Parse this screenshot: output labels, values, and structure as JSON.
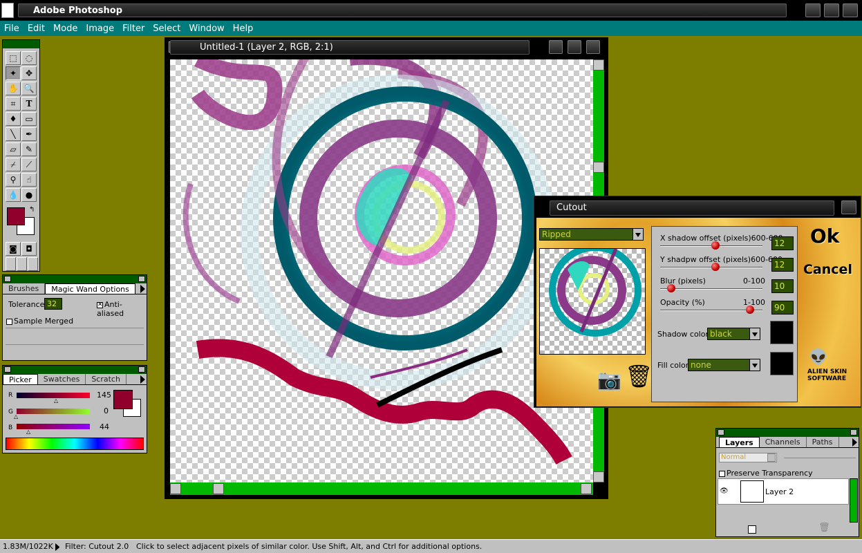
{
  "app": {
    "title": "Adobe Photoshop"
  },
  "menu": [
    "File",
    "Edit",
    "Mode",
    "Image",
    "Filter",
    "Select",
    "Window",
    "Help"
  ],
  "document": {
    "title": "Untitled-1  (Layer 2, RGB, 2:1)"
  },
  "brushes_panel": {
    "tabs": [
      "Brushes",
      "Magic Wand Options"
    ],
    "tolerance_label": "Tolerance:",
    "tolerance_value": "32",
    "anti_aliased_label": "Anti-aliased",
    "sample_merged_label": "Sample Merged"
  },
  "picker_panel": {
    "tabs": [
      "Picker",
      "Swatches",
      "Scratch"
    ],
    "channels": [
      {
        "label": "R",
        "value": "145"
      },
      {
        "label": "G",
        "value": "0"
      },
      {
        "label": "B",
        "value": "44"
      }
    ],
    "foreground_color": "#91002c"
  },
  "cutout": {
    "title": "Cutout",
    "preset": "Ripped",
    "x_offset_label": "X shadow offset (pixels)",
    "x_offset_range": "600-600",
    "x_offset_value": "12",
    "y_offset_label": "Y shadpw offset (pixels)",
    "y_offset_range": "600-600",
    "y_offset_value": "12",
    "blur_label": "Blur (pixels)",
    "blur_range": "0-100",
    "blur_value": "10",
    "opacity_label": "Opacity (%)",
    "opacity_range": "1-100",
    "opacity_value": "90",
    "shadow_color_label": "Shadow color:",
    "shadow_color_value": "black",
    "fill_color_label": "Fill color:",
    "fill_color_value": "none",
    "ok_label": "Ok",
    "cancel_label": "Cancel",
    "logo_text": "ALIEN SKIN SOFTWARE"
  },
  "layers_panel": {
    "tabs": [
      "Layers",
      "Channels",
      "Paths"
    ],
    "blend_mode": "Normal",
    "preserve_label": "Preserve Transparency",
    "layer_name": "Layer 2"
  },
  "status": {
    "doc_size": "1.83M/1022K",
    "filter": "Filter: Cutout 2.0",
    "hint": "Click to select adjacent pixels of similar color.  Use Shift, Alt, and Ctrl for additional options."
  }
}
